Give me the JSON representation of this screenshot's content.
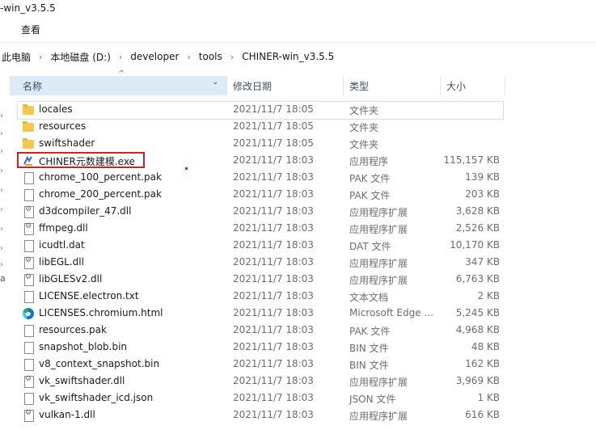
{
  "window": {
    "title_fragment": "-win_v3.5.5"
  },
  "menu": {
    "view": "查看"
  },
  "breadcrumb": [
    "此电脑",
    "本地磁盘 (D:)",
    "developer",
    "tools",
    "CHINER-win_v3.5.5"
  ],
  "columns": {
    "name": "名称",
    "date": "修改日期",
    "type": "类型",
    "size": "大小"
  },
  "left_fragment": "a",
  "files": [
    {
      "name": "locales",
      "date": "2021/11/7 18:05",
      "type": "文件夹",
      "size": "",
      "icon": "folder-icon"
    },
    {
      "name": "resources",
      "date": "2021/11/7 18:05",
      "type": "文件夹",
      "size": "",
      "icon": "folder-icon"
    },
    {
      "name": "swiftshader",
      "date": "2021/11/7 18:05",
      "type": "文件夹",
      "size": "",
      "icon": "folder-icon"
    },
    {
      "name": "CHINER元数建模.exe",
      "date": "2021/11/7 18:03",
      "type": "应用程序",
      "size": "115,157 KB",
      "icon": "app-icon"
    },
    {
      "name": "chrome_100_percent.pak",
      "date": "2021/11/7 18:03",
      "type": "PAK 文件",
      "size": "139 KB",
      "icon": "file-icon"
    },
    {
      "name": "chrome_200_percent.pak",
      "date": "2021/11/7 18:03",
      "type": "PAK 文件",
      "size": "203 KB",
      "icon": "file-icon"
    },
    {
      "name": "d3dcompiler_47.dll",
      "date": "2021/11/7 18:03",
      "type": "应用程序扩展",
      "size": "3,628 KB",
      "icon": "dll-icon"
    },
    {
      "name": "ffmpeg.dll",
      "date": "2021/11/7 18:03",
      "type": "应用程序扩展",
      "size": "2,526 KB",
      "icon": "dll-icon"
    },
    {
      "name": "icudtl.dat",
      "date": "2021/11/7 18:03",
      "type": "DAT 文件",
      "size": "10,170 KB",
      "icon": "file-icon"
    },
    {
      "name": "libEGL.dll",
      "date": "2021/11/7 18:03",
      "type": "应用程序扩展",
      "size": "347 KB",
      "icon": "dll-icon"
    },
    {
      "name": "libGLESv2.dll",
      "date": "2021/11/7 18:03",
      "type": "应用程序扩展",
      "size": "6,763 KB",
      "icon": "dll-icon"
    },
    {
      "name": "LICENSE.electron.txt",
      "date": "2021/11/7 18:03",
      "type": "文本文档",
      "size": "2 KB",
      "icon": "file-icon"
    },
    {
      "name": "LICENSES.chromium.html",
      "date": "2021/11/7 18:03",
      "type": "Microsoft Edge ...",
      "size": "5,245 KB",
      "icon": "edge-icon"
    },
    {
      "name": "resources.pak",
      "date": "2021/11/7 18:03",
      "type": "PAK 文件",
      "size": "4,968 KB",
      "icon": "file-icon"
    },
    {
      "name": "snapshot_blob.bin",
      "date": "2021/11/7 18:03",
      "type": "BIN 文件",
      "size": "48 KB",
      "icon": "file-icon"
    },
    {
      "name": "v8_context_snapshot.bin",
      "date": "2021/11/7 18:03",
      "type": "BIN 文件",
      "size": "162 KB",
      "icon": "file-icon"
    },
    {
      "name": "vk_swiftshader.dll",
      "date": "2021/11/7 18:03",
      "type": "应用程序扩展",
      "size": "3,969 KB",
      "icon": "dll-icon"
    },
    {
      "name": "vk_swiftshader_icd.json",
      "date": "2021/11/7 18:03",
      "type": "JSON 文件",
      "size": "1 KB",
      "icon": "file-icon"
    },
    {
      "name": "vulkan-1.dll",
      "date": "2021/11/7 18:03",
      "type": "应用程序扩展",
      "size": "616 KB",
      "icon": "dll-icon"
    }
  ],
  "selected_index": 0,
  "highlight_color": "#d42020",
  "header_highlight_color": "#dcebf7"
}
